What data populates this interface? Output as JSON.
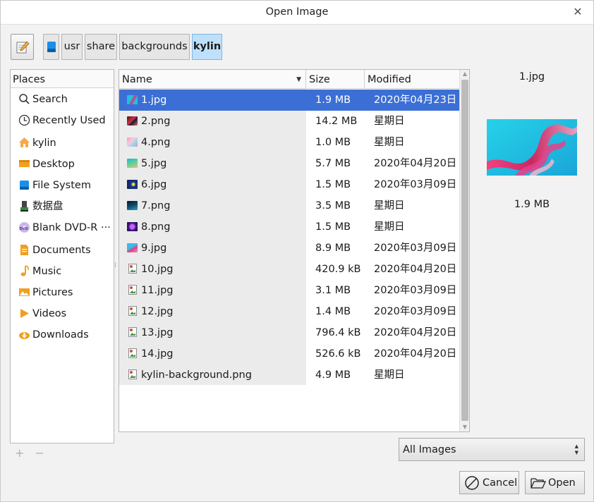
{
  "window": {
    "title": "Open Image"
  },
  "pathbar": {
    "segments": [
      "usr",
      "share",
      "backgrounds",
      "kylin"
    ],
    "active_index": 3
  },
  "places": {
    "header": "Places",
    "items": [
      {
        "label": "Search",
        "icon": "search-icon"
      },
      {
        "label": "Recently Used",
        "icon": "clock-icon"
      },
      {
        "label": "kylin",
        "icon": "home-icon"
      },
      {
        "label": "Desktop",
        "icon": "desktop-icon"
      },
      {
        "label": "File System",
        "icon": "drive-icon"
      },
      {
        "label": "数据盘",
        "icon": "usb-drive-icon"
      },
      {
        "label": "Blank DVD-R ···",
        "icon": "dvd-icon"
      },
      {
        "label": "Documents",
        "icon": "documents-folder-icon"
      },
      {
        "label": "Music",
        "icon": "music-icon"
      },
      {
        "label": "Pictures",
        "icon": "pictures-folder-icon"
      },
      {
        "label": "Videos",
        "icon": "videos-icon"
      },
      {
        "label": "Downloads",
        "icon": "downloads-icon"
      }
    ],
    "add_label": "+",
    "remove_label": "−"
  },
  "files": {
    "columns": {
      "name": "Name",
      "size": "Size",
      "modified": "Modified"
    },
    "selected_index": 0,
    "rows": [
      {
        "name": "1.jpg",
        "size": "1.9 MB",
        "modified": "2020年04月23日"
      },
      {
        "name": "2.png",
        "size": "14.2 MB",
        "modified": "星期日"
      },
      {
        "name": "4.png",
        "size": "1.0 MB",
        "modified": "星期日"
      },
      {
        "name": "5.jpg",
        "size": "5.7 MB",
        "modified": "2020年04月20日"
      },
      {
        "name": "6.jpg",
        "size": "1.5 MB",
        "modified": "2020年03月09日"
      },
      {
        "name": "7.png",
        "size": "3.5 MB",
        "modified": "星期日"
      },
      {
        "name": "8.png",
        "size": "1.5 MB",
        "modified": "星期日"
      },
      {
        "name": "9.jpg",
        "size": "8.9 MB",
        "modified": "2020年03月09日"
      },
      {
        "name": "10.jpg",
        "size": "420.9 kB",
        "modified": "2020年04月20日"
      },
      {
        "name": "11.jpg",
        "size": "3.1 MB",
        "modified": "2020年03月09日"
      },
      {
        "name": "12.jpg",
        "size": "1.4 MB",
        "modified": "2020年03月09日"
      },
      {
        "name": "13.jpg",
        "size": "796.4 kB",
        "modified": "2020年04月20日"
      },
      {
        "name": "14.jpg",
        "size": "526.6 kB",
        "modified": "2020年04月20日"
      },
      {
        "name": "kylin-background.png",
        "size": "4.9 MB",
        "modified": "星期日"
      }
    ]
  },
  "preview": {
    "name": "1.jpg",
    "size": "1.9 MB"
  },
  "filter": {
    "selected": "All Images"
  },
  "buttons": {
    "cancel": "Cancel",
    "open": "Open"
  },
  "colors": {
    "selection": "#3b6fd6",
    "active_crumb": "#bfe0fb"
  }
}
